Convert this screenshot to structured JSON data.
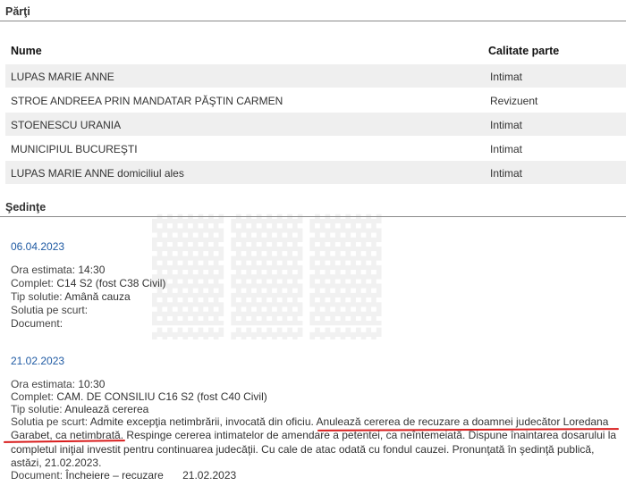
{
  "parti": {
    "title": "Părţi",
    "col_name": "Nume",
    "col_role": "Calitate parte",
    "rows": [
      {
        "name": "LUPAS MARIE ANNE",
        "role": "Intimat"
      },
      {
        "name": "STROE ANDREEA PRIN MANDATAR PĂŞTIN CARMEN",
        "role": "Revizuent"
      },
      {
        "name": "STOENESCU URANIA",
        "role": "Intimat"
      },
      {
        "name": "MUNICIPIUL BUCUREŞTI",
        "role": "Intimat"
      },
      {
        "name": "LUPAS MARIE ANNE domiciliul ales",
        "role": "Intimat"
      }
    ]
  },
  "sedinte": {
    "title": "Şedinţe",
    "items": [
      {
        "date": "06.04.2023",
        "ora_label": "Ora estimata:",
        "ora": "14:30",
        "complet_label": "Complet:",
        "complet": "C14 S2 (fost C38 Civil)",
        "tip_label": "Tip solutie:",
        "tip": "Amână cauza",
        "solutia_label": "Solutia pe scurt:",
        "solutia": "",
        "document_label": "Document:",
        "document": ""
      },
      {
        "date": "21.02.2023",
        "ora_label": "Ora estimata:",
        "ora": "10:30",
        "complet_label": "Complet:",
        "complet": "CAM. DE CONSILIU C16 S2 (fost C40 Civil)",
        "tip_label": "Tip solutie:",
        "tip": "Anulează cererea",
        "solutia_label": "Solutia pe scurt:",
        "solutia_a": "Admite excepţia netimbrării, invocată din oficiu.",
        "solutia_b": "Anulează cererea de recuzare a doamnei judecător Loredana Garabet, ca netimbrată.",
        "solutia_c": "Respinge cererea intimatelor de amendare a petentei, ca neîntemeiată. Dispune înaintarea dosarului la completul iniţial investit pentru continuarea judecăţii. Cu cale de atac odată cu fondul cauzei. Pronunţată în şedinţă publică, astăzi, 21.02.2023.",
        "document_label": "Document:",
        "document": "Încheiere – recuzare",
        "document_date": "21.02.2023"
      }
    ]
  },
  "colors": {
    "date": "#1f5aa3",
    "row_alt": "#efefef",
    "underline": "#d81c1c"
  }
}
